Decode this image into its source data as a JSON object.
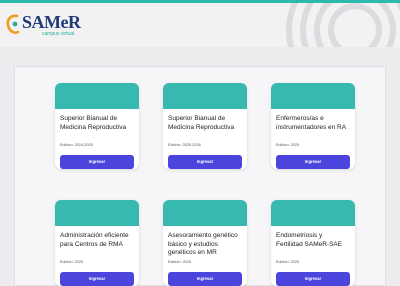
{
  "brand": {
    "name": "SAMeR",
    "subtitle": "campus virtual",
    "colors": {
      "navy": "#1f3b78",
      "teal": "#38b9b0",
      "orange": "#f29a1f",
      "button": "#4b45de"
    }
  },
  "courses": [
    {
      "title": "Superior Bianual de Medicina Reproductiva",
      "edition": "Edición: 2024-2025",
      "button": "Ingresar"
    },
    {
      "title": "Superior Bianual de Medicina Reproductiva",
      "edition": "Edición: 2025-2026",
      "button": "Ingresar"
    },
    {
      "title": "Enfermeros/as e instrumentadores en RA",
      "edition": "Edición: 2025",
      "button": "Ingresar"
    },
    {
      "title": "Administración eficiente para Centros de RMA",
      "edition": "Edición: 2025",
      "button": "Ingresar"
    },
    {
      "title": "Asesoramiento genético básico y estudios genéticos en MR",
      "edition": "Edición: 2025",
      "button": "Ingresar"
    },
    {
      "title": "Endometriosis y Fertilidad SAMeR-SAE",
      "edition": "Edición: 2025",
      "button": "Ingresar"
    }
  ]
}
